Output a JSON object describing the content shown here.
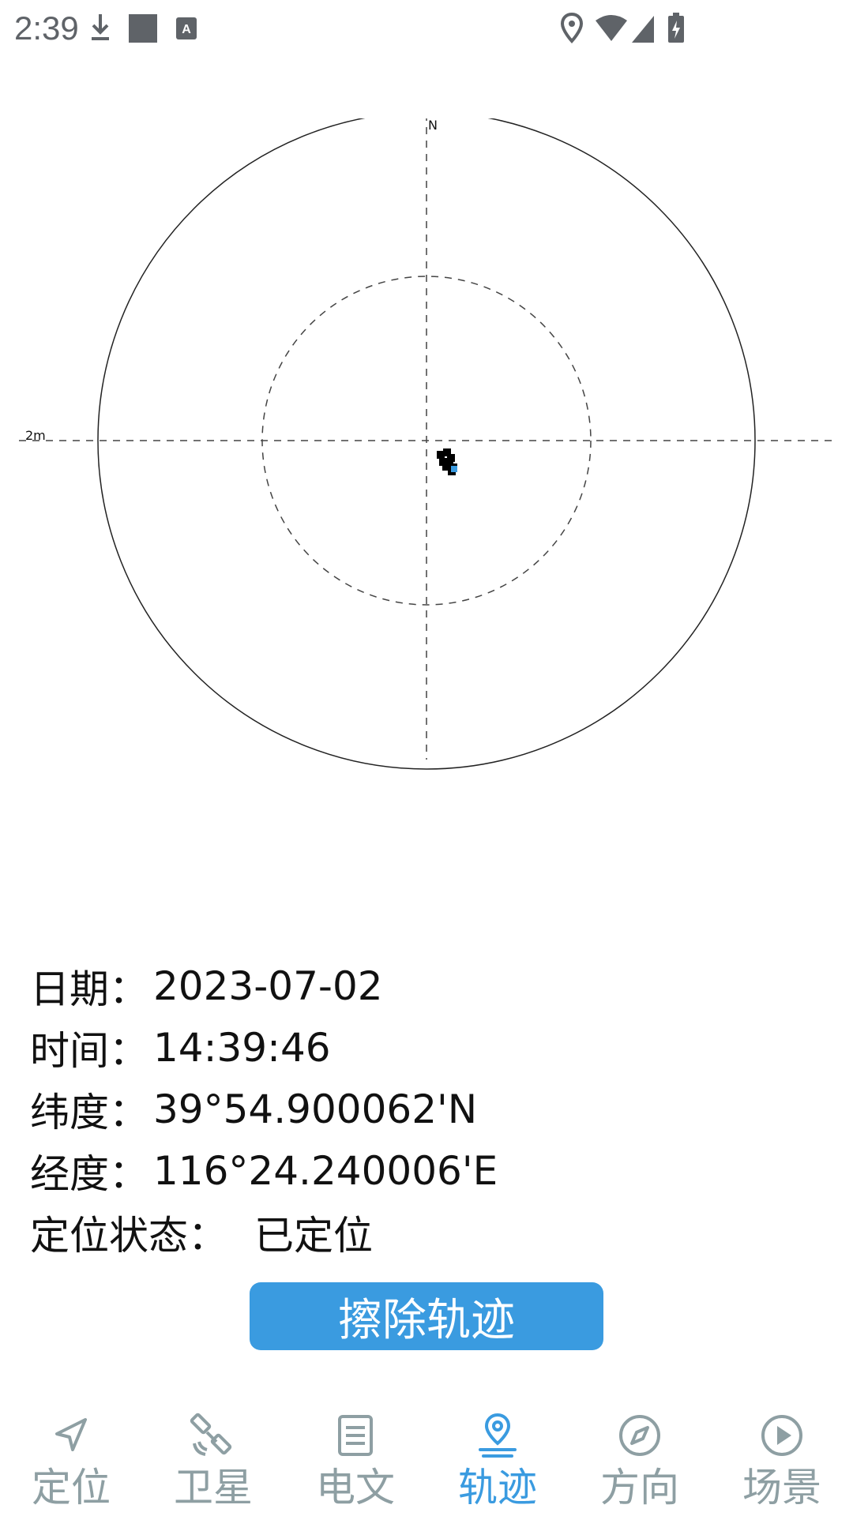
{
  "status_bar": {
    "time": "2:39",
    "left_icons": [
      "download-icon",
      "square-icon",
      "keyboard-a-icon"
    ],
    "right_icons": [
      "location-pin-icon",
      "wifi-icon",
      "signal-icon",
      "battery-charging-icon"
    ]
  },
  "plot": {
    "north_label": "N",
    "scale_label": "2m",
    "colors": {
      "ring": "#222222",
      "dash": "#444444",
      "points": "#000000",
      "current_point": "#3a9be0"
    }
  },
  "info": {
    "date_label": "日期：",
    "date_value": "2023-07-02",
    "time_label": "时间：",
    "time_value": "14:39:46",
    "lat_label": "纬度：",
    "lat_value": "39°54.900062'N",
    "lon_label": "经度：",
    "lon_value": "116°24.240006'E",
    "status_label": "定位状态：",
    "status_value": "已定位"
  },
  "erase_button": {
    "label": "擦除轨迹",
    "color": "#3a9be0"
  },
  "nav": {
    "active_color": "#3a9be0",
    "inactive_color": "#8e9fa3",
    "items": [
      {
        "label": "定位",
        "icon": "navigation-arrow-icon",
        "active": false
      },
      {
        "label": "卫星",
        "icon": "satellite-icon",
        "active": false
      },
      {
        "label": "电文",
        "icon": "document-icon",
        "active": false
      },
      {
        "label": "轨迹",
        "icon": "track-pin-icon",
        "active": true
      },
      {
        "label": "方向",
        "icon": "compass-icon",
        "active": false
      },
      {
        "label": "场景",
        "icon": "play-circle-icon",
        "active": false
      }
    ]
  }
}
